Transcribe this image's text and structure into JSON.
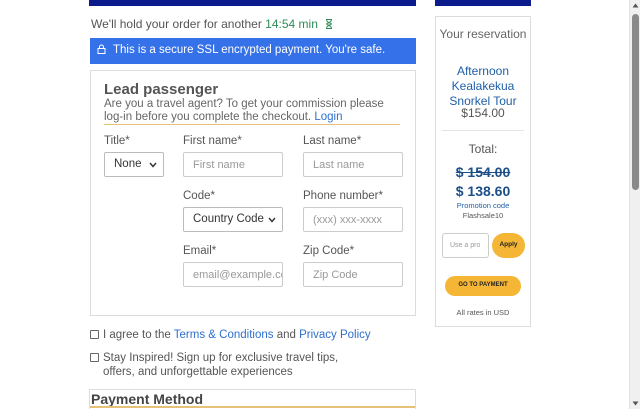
{
  "hold": {
    "text": "We'll hold your order for another",
    "timer": "14:54 min",
    "icon": "hourglass-icon"
  },
  "ssl": {
    "text": "This is a secure SSL encrypted payment. You're safe.",
    "icon": "lock-icon"
  },
  "lead": {
    "title": "Lead passenger",
    "agent_text": "Are you a travel agent? To get your commission please log-in before you complete the checkout.",
    "login_link": "Login"
  },
  "form": {
    "title_label": "Title*",
    "title_value": "None",
    "first_name_label": "First name*",
    "first_name_placeholder": "First name",
    "last_name_label": "Last name*",
    "last_name_placeholder": "Last name",
    "code_label": "Code*",
    "code_value": "Country Code",
    "phone_label": "Phone number*",
    "phone_placeholder": "(xxx) xxx-xxxx",
    "email_label": "Email*",
    "email_placeholder": "email@example.co",
    "zip_label": "Zip Code*",
    "zip_placeholder": "Zip Code"
  },
  "consent": {
    "prefix": "I agree to the",
    "terms_link": "Terms & Conditions",
    "and": "and",
    "privacy_link": "Privacy Policy",
    "newsletter": "Stay Inspired! Sign up for exclusive travel tips, offers, and unforgettable experiences"
  },
  "payment": {
    "title": "Payment Method"
  },
  "reservation": {
    "heading": "Your reservation",
    "tour_name": "Afternoon Kealakekua Snorkel Tour",
    "tour_price": "$154.00",
    "total_label": "Total:",
    "old_price": "$ 154.00",
    "new_price": "$ 138.60",
    "promo_label": "Promotion code",
    "promo_code": "Flashsale10",
    "promo_placeholder": "Use a pro",
    "apply_label": "Apply",
    "go_to_payment": "GO TO PAYMENT",
    "rates_note": "All rates in USD"
  },
  "colors": {
    "brand_navy": "#0b1b8c",
    "ssl_blue": "#3571e8",
    "timer_green": "#2e8b57",
    "accent_gold": "#f4b634",
    "price_blue": "#1c4f88",
    "link_blue": "#2f6fcf"
  }
}
